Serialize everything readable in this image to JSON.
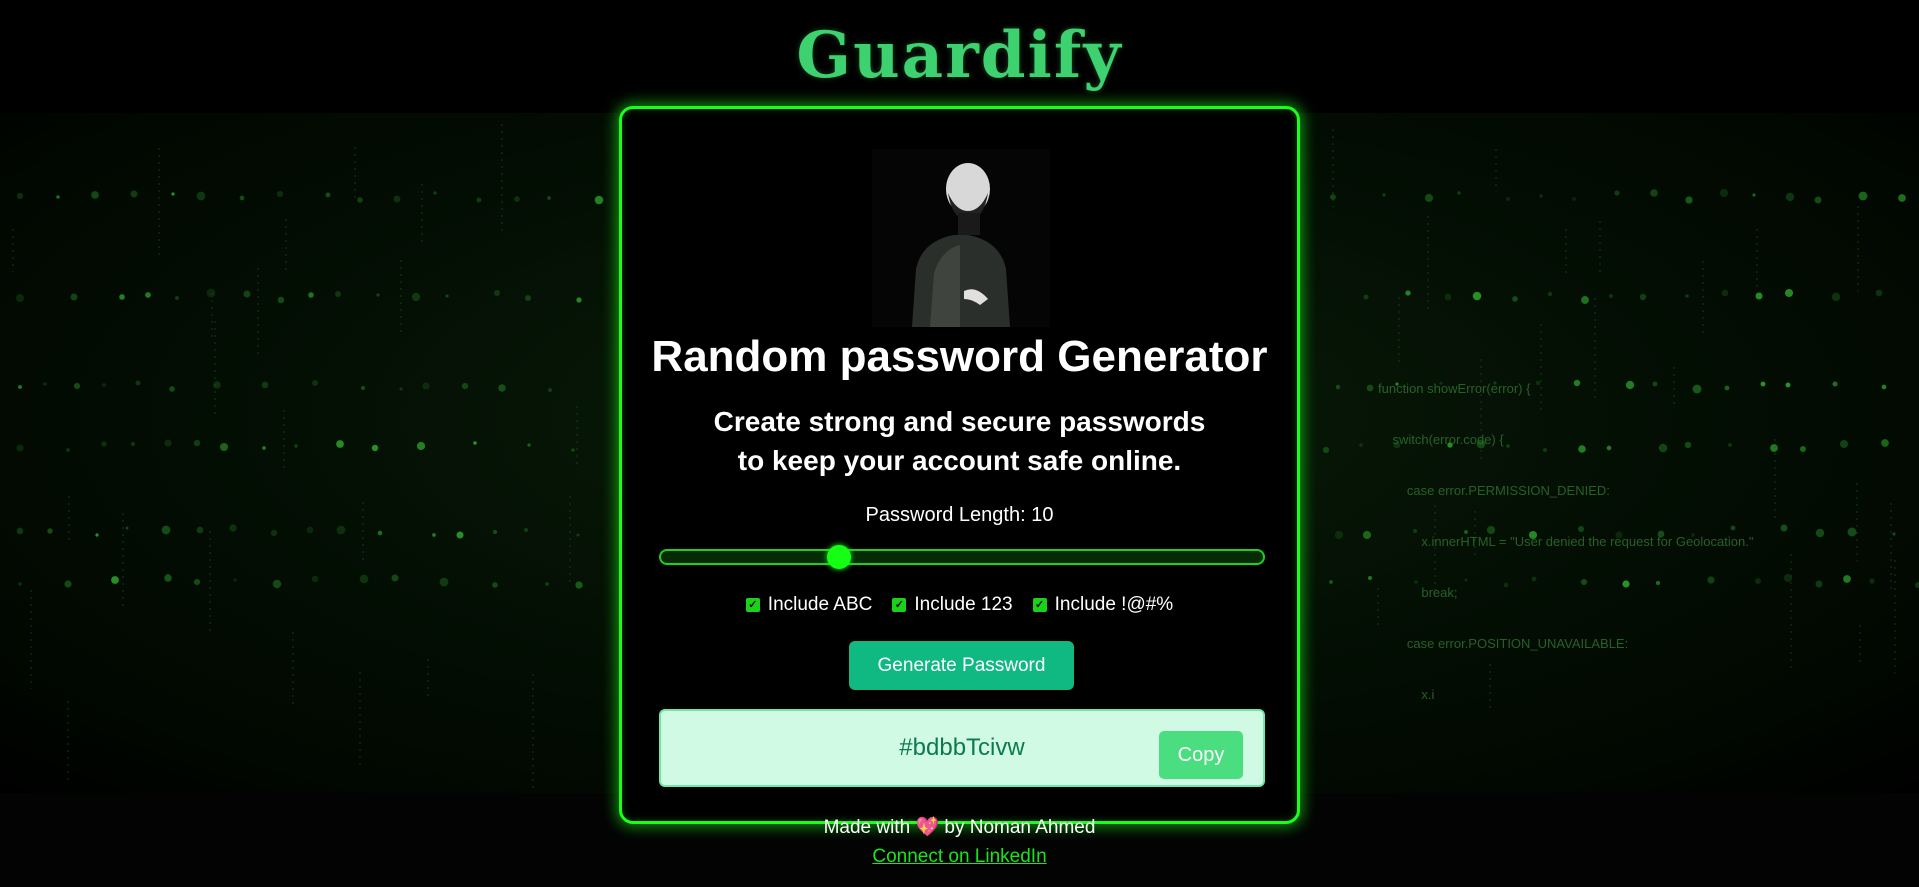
{
  "brand": {
    "logo_text": "Guardify",
    "accent_color": "#19ff19",
    "logo_color": "#3ed16f"
  },
  "card": {
    "avatar": "hacker-silhouette-image",
    "title": "Random password Generator",
    "subtitle_line1": "Create strong and secure passwords",
    "subtitle_line2": "to keep your account safe online.",
    "length_label": "Password Length: 10",
    "length_value": 10,
    "slider_fraction": 0.295,
    "options": [
      {
        "label": "Include ABC",
        "checked": true
      },
      {
        "label": "Include 123",
        "checked": true
      },
      {
        "label": "Include !@#%",
        "checked": true
      }
    ],
    "generate_label": "Generate Password",
    "password": "#bdbbTcivw",
    "copy_label": "Copy"
  },
  "background_code": [
    "function showError(error) {",
    "    switch(error.code) {",
    "        case error.PERMISSION_DENIED:",
    "            x.innerHTML = \"User denied the request for Geolocation.\"",
    "            break;",
    "        case error.POSITION_UNAVAILABLE:",
    "            x.i"
  ],
  "footer": {
    "made_with": "Made with",
    "heart": "💖",
    "by": "by Noman Ahmed",
    "link_label": "Connect on LinkedIn"
  }
}
